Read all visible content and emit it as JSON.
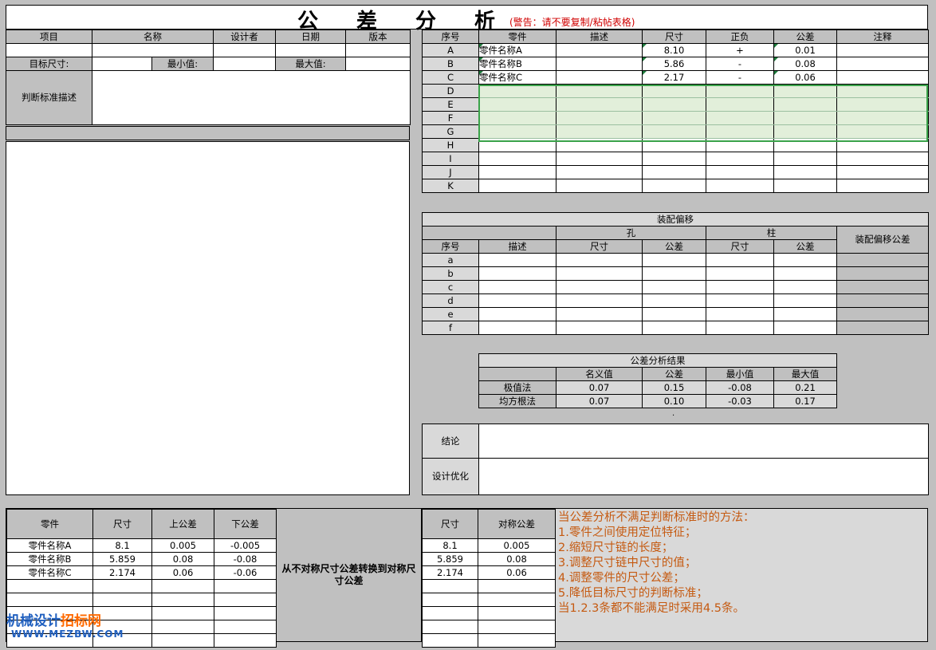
{
  "header": {
    "title": "公差分析",
    "warning": "(警告：请不要复制/粘帖表格)"
  },
  "project": {
    "col_item": "项目",
    "col_name": "名称",
    "col_designer": "设计者",
    "col_date": "日期",
    "col_version": "版本",
    "target_size": "目标尺寸:",
    "min_value": "最小值:",
    "max_value": "最大值:",
    "criteria": "判断标准描述"
  },
  "chain": {
    "headers": [
      "序号",
      "零件",
      "描述",
      "尺寸",
      "正负",
      "公差",
      "注释"
    ],
    "rows": [
      {
        "id": "A",
        "part": "零件名称A",
        "desc": "",
        "size": "8.10",
        "sign": "+",
        "tol": "0.01",
        "note": ""
      },
      {
        "id": "B",
        "part": "零件名称B",
        "desc": "",
        "size": "5.86",
        "sign": "-",
        "tol": "0.08",
        "note": ""
      },
      {
        "id": "C",
        "part": "零件名称C",
        "desc": "",
        "size": "2.17",
        "sign": "-",
        "tol": "0.06",
        "note": ""
      },
      {
        "id": "D"
      },
      {
        "id": "E"
      },
      {
        "id": "F"
      },
      {
        "id": "G"
      },
      {
        "id": "H"
      },
      {
        "id": "I"
      },
      {
        "id": "J"
      },
      {
        "id": "K"
      }
    ]
  },
  "assembly": {
    "title": "装配偏移",
    "hole": "孔",
    "shaft": "柱",
    "offset_tol": "装配偏移公差",
    "headers": [
      "序号",
      "描述",
      "尺寸",
      "公差",
      "尺寸",
      "公差"
    ],
    "rows": [
      "a",
      "b",
      "c",
      "d",
      "e",
      "f"
    ]
  },
  "result": {
    "title": "公差分析结果",
    "headers": [
      "名义值",
      "公差",
      "最小值",
      "最大值"
    ],
    "rows": [
      {
        "method": "极值法",
        "nominal": "0.07",
        "tol": "0.15",
        "min": "-0.08",
        "max": "0.21"
      },
      {
        "method": "均方根法",
        "nominal": "0.07",
        "tol": "0.10",
        "min": "-0.03",
        "max": "0.17"
      }
    ],
    "dot": "."
  },
  "conclusion": {
    "label": "结论",
    "optimize": "设计优化"
  },
  "convert": {
    "headers": [
      "零件",
      "尺寸",
      "上公差",
      "下公差"
    ],
    "rows": [
      {
        "part": "零件名称A",
        "size": "8.1",
        "upper": "0.005",
        "lower": "-0.005"
      },
      {
        "part": "零件名称B",
        "size": "5.859",
        "upper": "0.08",
        "lower": "-0.08"
      },
      {
        "part": "零件名称C",
        "size": "2.174",
        "upper": "0.06",
        "lower": "-0.06"
      },
      {},
      {},
      {},
      {},
      {}
    ],
    "middle": "从不对称尺寸公差转换到对称尺寸公差",
    "sym_headers": [
      "尺寸",
      "对称公差"
    ],
    "sym_rows": [
      {
        "size": "8.1",
        "tol": "0.005"
      },
      {
        "size": "5.859",
        "tol": "0.08"
      },
      {
        "size": "2.174",
        "tol": "0.06"
      },
      {},
      {},
      {},
      {},
      {}
    ]
  },
  "methods": {
    "lines": [
      "当公差分析不满足判断标准时的方法：",
      "1.零件之间使用定位特征；",
      "2.缩短尺寸链的长度；",
      "3.调整尺寸链中尺寸的值；",
      "4.调整零件的尺寸公差；",
      "5.降低目标尺寸的判断标准；",
      "当1.2.3条都不能满足时采用4.5条。"
    ]
  },
  "watermark": {
    "text_a": "机械设计",
    "text_b": "招标网",
    "url": "WWW.MEZBW.COM"
  }
}
